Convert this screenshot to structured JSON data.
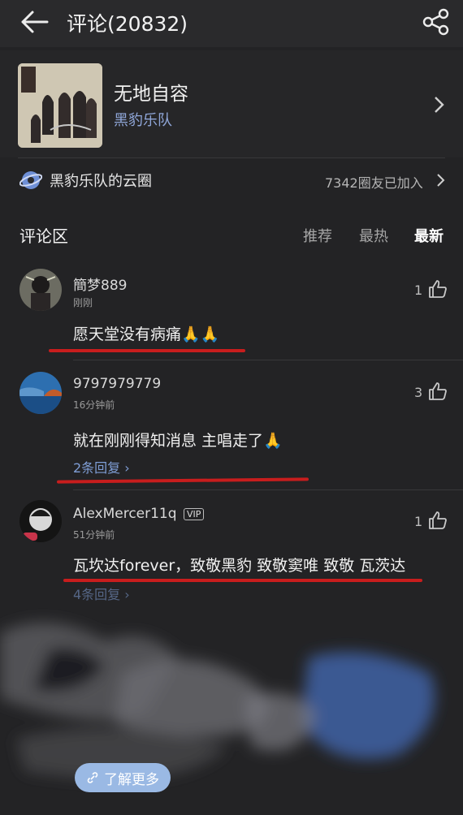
{
  "header": {
    "title": "评论(20832)"
  },
  "song": {
    "title": "无地自容",
    "artist": "黑豹乐队"
  },
  "circle": {
    "name": "黑豹乐队的云圈",
    "count": "7342圈友已加入"
  },
  "comments_section": {
    "label": "评论区",
    "tabs": [
      "推荐",
      "最热",
      "最新"
    ],
    "active_tab": "最新"
  },
  "comments": [
    {
      "username": "簡梦889",
      "time": "刚刚",
      "likes": "1",
      "text": "愿天堂没有病痛🙏🙏",
      "replies": ""
    },
    {
      "username": "9797979779",
      "time": "16分钟前",
      "likes": "3",
      "text": "就在刚刚得知消息 主唱走了🙏",
      "replies": "2条回复"
    },
    {
      "username": "AlexMercer11q",
      "badge": "VIP",
      "time": "51分钟前",
      "likes": "1",
      "text": "瓦坎达forever，致敬黑豹 致敬窦唯 致敬 瓦茨达",
      "replies": "4条回复"
    }
  ],
  "footer": {
    "learn_more": "了解更多"
  },
  "colors": {
    "background": "#232325",
    "accent_blue": "#8fa6d8",
    "red_underline": "#c81d1d"
  },
  "icons": [
    "back-arrow-icon",
    "share-icon",
    "chevron-right-icon",
    "cloud-circle-icon",
    "thumb-up-icon",
    "link-icon"
  ]
}
